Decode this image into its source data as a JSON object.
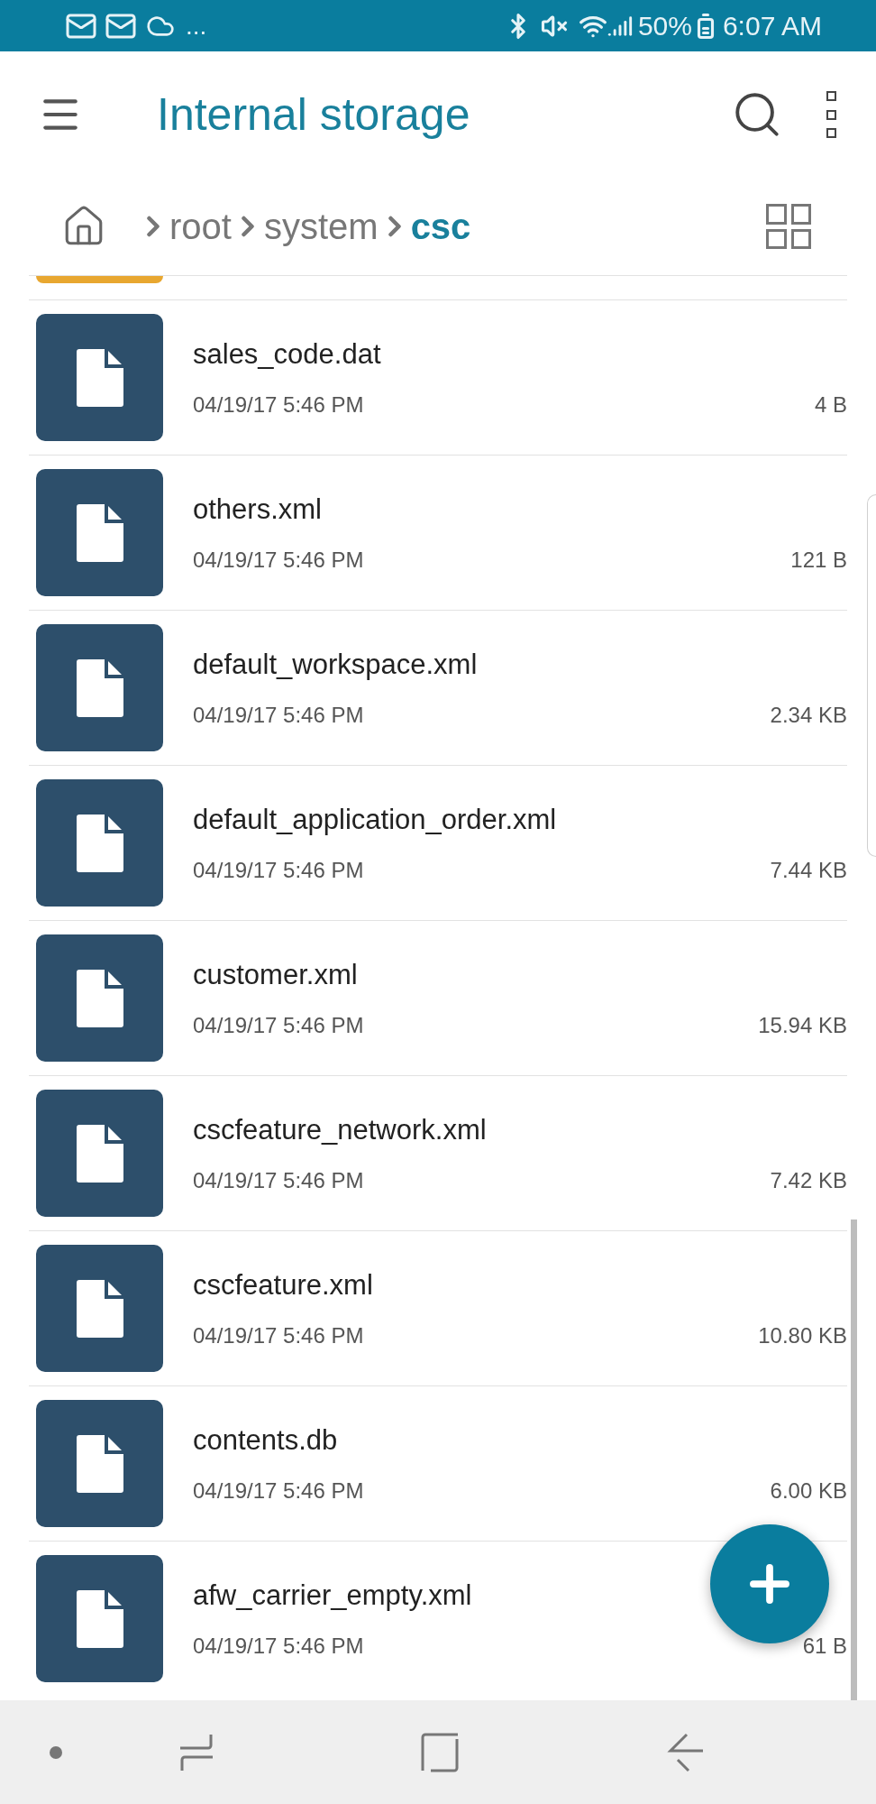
{
  "status_bar": {
    "overflow": "...",
    "battery": "50%",
    "time": "6:07 AM"
  },
  "header": {
    "title": "Internal storage"
  },
  "breadcrumb": [
    {
      "label": "root",
      "current": false
    },
    {
      "label": "system",
      "current": false
    },
    {
      "label": "csc",
      "current": true
    }
  ],
  "files": [
    {
      "name": "sales_code.dat",
      "date": "04/19/17 5:46 PM",
      "size": "4 B"
    },
    {
      "name": "others.xml",
      "date": "04/19/17 5:46 PM",
      "size": "121 B"
    },
    {
      "name": "default_workspace.xml",
      "date": "04/19/17 5:46 PM",
      "size": "2.34 KB"
    },
    {
      "name": "default_application_order.xml",
      "date": "04/19/17 5:46 PM",
      "size": "7.44 KB"
    },
    {
      "name": "customer.xml",
      "date": "04/19/17 5:46 PM",
      "size": "15.94 KB"
    },
    {
      "name": "cscfeature_network.xml",
      "date": "04/19/17 5:46 PM",
      "size": "7.42 KB"
    },
    {
      "name": "cscfeature.xml",
      "date": "04/19/17 5:46 PM",
      "size": "10.80 KB"
    },
    {
      "name": "contents.db",
      "date": "04/19/17 5:46 PM",
      "size": "6.00 KB"
    },
    {
      "name": "afw_carrier_empty.xml",
      "date": "04/19/17 5:46 PM",
      "size": "61 B"
    }
  ]
}
